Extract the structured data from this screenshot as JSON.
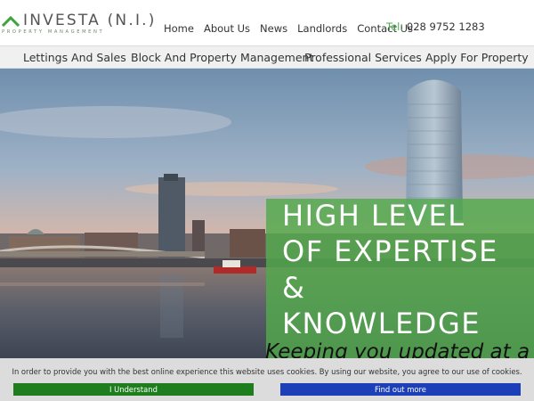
{
  "header": {
    "logo_name": "INVESTA (N.I.)",
    "logo_tagline": "PROPERTY MANAGEMENT",
    "nav": [
      "Home",
      "About Us",
      "News",
      "Landlords",
      "Contact Us"
    ],
    "phone_label": "Tel:",
    "phone_number": "028 9752 1283"
  },
  "main_nav": [
    "Lettings And Sales",
    "Block And Property Management",
    "Professional Services",
    "Apply For Property"
  ],
  "hero": {
    "headline_lines": [
      "HIGH LEVEL",
      "OF EXPERTISE",
      "&",
      "KNOWLEDGE"
    ],
    "subheadline": "Keeping you updated at a"
  },
  "cookie_banner": {
    "message": "In order to provide you with the best online experience this website uses cookies. By using our website, you agree to our use of cookies.",
    "accept_label": "I Understand",
    "more_label": "Find out more"
  },
  "colors": {
    "brand_green": "#4caf50",
    "overlay_green": "#52aa4c",
    "accept_button": "#1e7e1e",
    "more_button": "#1d3fb8"
  }
}
